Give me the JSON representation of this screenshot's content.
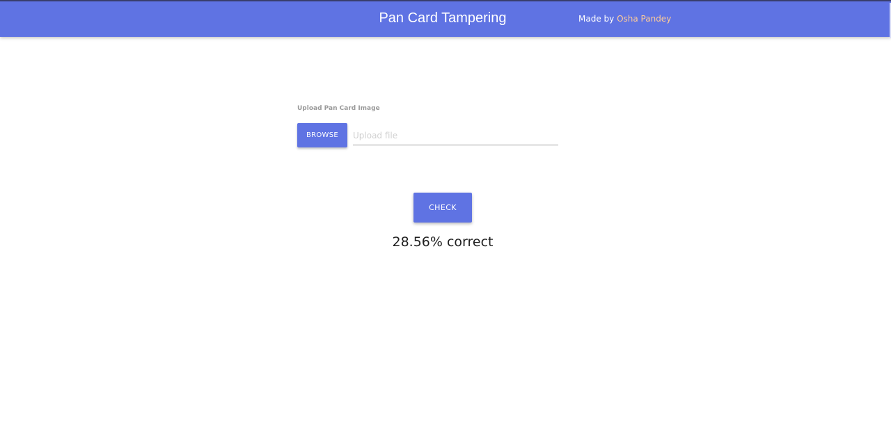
{
  "header": {
    "title": "Pan Card Tampering",
    "credit_prefix": "Made by ",
    "credit_author": "Osha Pandey"
  },
  "form": {
    "upload_label": "Upload Pan Card Image",
    "browse_label": "BROWSE",
    "file_placeholder": "Upload file",
    "file_value": ""
  },
  "actions": {
    "check_label": "CHECK"
  },
  "result": {
    "text": "28.56% correct"
  },
  "colors": {
    "primary": "#5f73e3",
    "accent_link": "#ffcc99",
    "label_gray": "#9a9a9a"
  }
}
